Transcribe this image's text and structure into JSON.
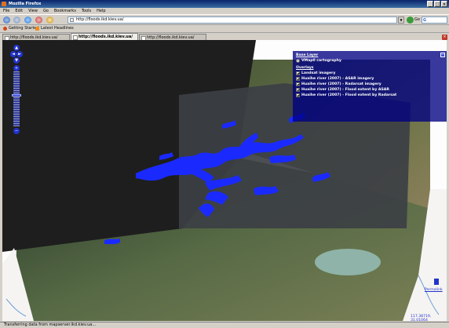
{
  "window": {
    "title": "Mozilla Firefox",
    "controls": [
      "_",
      "□",
      "×"
    ]
  },
  "menu": [
    "File",
    "Edit",
    "View",
    "Go",
    "Bookmarks",
    "Tools",
    "Help"
  ],
  "nav": {
    "url": "http://floods.ikd.kiev.ua/",
    "go_label": "Go",
    "search_engine_icon": "google-icon"
  },
  "bookmarks": [
    {
      "label": "Getting Started",
      "icon": "firefox-icon",
      "color": "#d0461b"
    },
    {
      "label": "Latest Headlines",
      "icon": "rss-icon",
      "color": "#f08c1c"
    }
  ],
  "tabs": [
    {
      "label": "http://floods.ikd.kiev.ua/",
      "active": false
    },
    {
      "label": "http://floods.ikd.kiev.ua/",
      "active": true
    },
    {
      "label": "http://floods.ikd.kiev.ua/",
      "active": false
    }
  ],
  "layer_switcher": {
    "base_header": "Base Layer",
    "base_layers": [
      "VMap0 cartography"
    ],
    "overlay_header": "Overlays",
    "overlays": [
      "Landsat imagery",
      "Huaihe river (2007) - ASAR imagery",
      "Huaihe river (2007) - Radarsat imagery",
      "Huaihe river (2007) - Flood extent by ASAR",
      "Huaihe river (2007) - Flood extent by Radarsat"
    ],
    "minimize_symbol": "−",
    "panel_color": "#00008c"
  },
  "map": {
    "permalink": "Permalink",
    "coordinates": "117.38719, 31.01064",
    "flood_color": "#1a2aff"
  },
  "status": "Transferring data from mapserver.ikd.kiev.ua..."
}
